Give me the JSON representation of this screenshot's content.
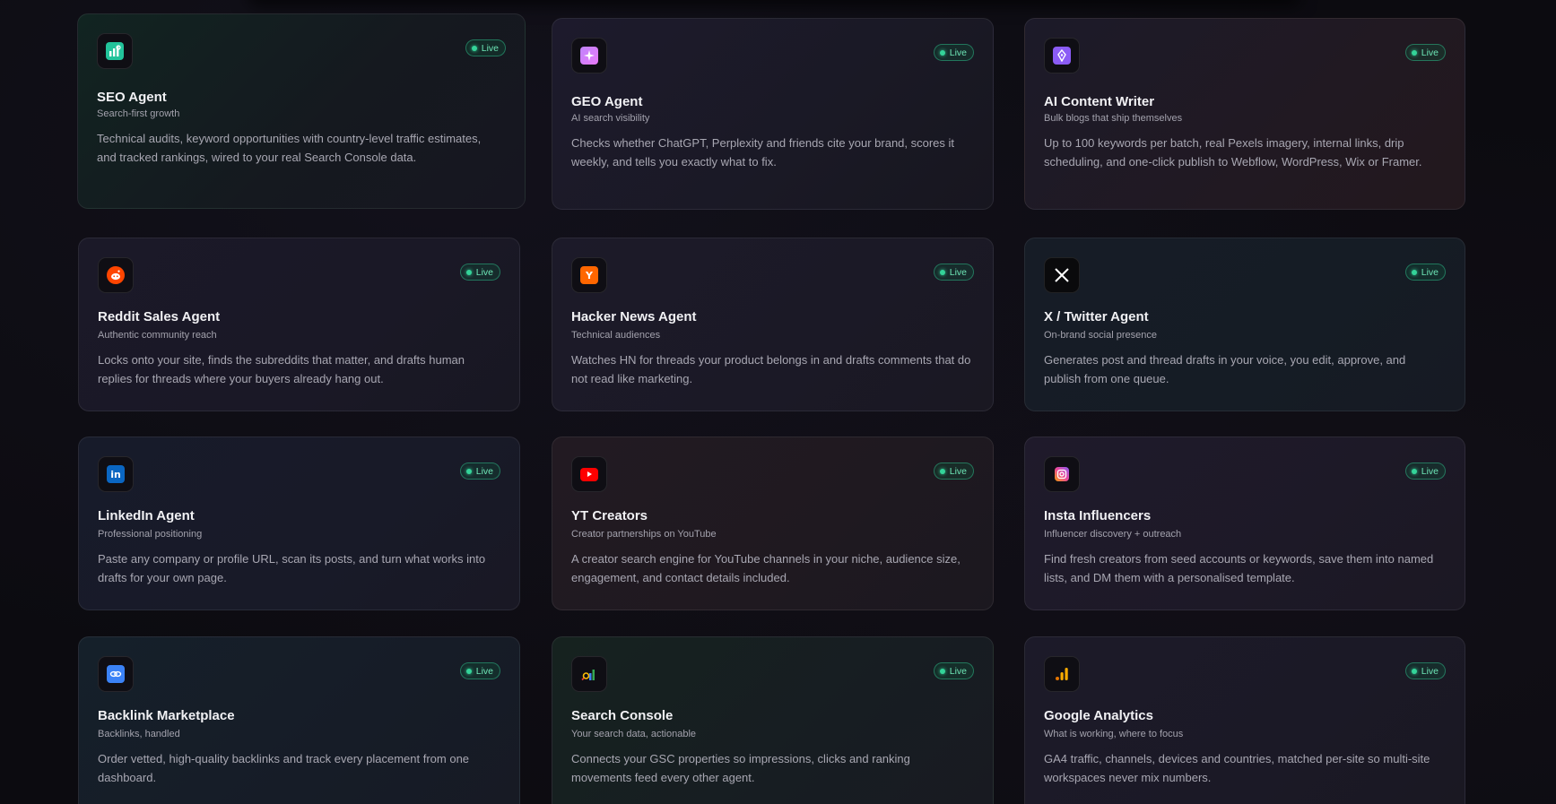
{
  "badge_label": "Live",
  "colors": {
    "accent_green": "#34d399",
    "card_text": "#f1f1f4"
  },
  "cards": [
    {
      "title": "SEO Agent",
      "subtitle": "Search-first growth",
      "description": "Technical audits, keyword opportunities with country-level traffic estimates, and tracked rankings, wired to your real Search Console data.",
      "icon": "bar-chart-icon"
    },
    {
      "title": "GEO Agent",
      "subtitle": "AI search visibility",
      "description": "Checks whether ChatGPT, Perplexity and friends cite your brand, scores it weekly, and tells you exactly what to fix.",
      "icon": "sparkle-icon"
    },
    {
      "title": "AI Content Writer",
      "subtitle": "Bulk blogs that ship themselves",
      "description": "Up to 100 keywords per batch, real Pexels imagery, internal links, drip scheduling, and one-click publish to Webflow, WordPress, Wix or Framer.",
      "icon": "pen-nib-icon"
    },
    {
      "title": "Reddit Sales Agent",
      "subtitle": "Authentic community reach",
      "description": "Locks onto your site, finds the subreddits that matter, and drafts human replies for threads where your buyers already hang out.",
      "icon": "reddit-icon"
    },
    {
      "title": "Hacker News Agent",
      "subtitle": "Technical audiences",
      "description": "Watches HN for threads your product belongs in and drafts comments that do not read like marketing.",
      "icon": "hacker-news-icon"
    },
    {
      "title": "X / Twitter Agent",
      "subtitle": "On-brand social presence",
      "description": "Generates post and thread drafts in your voice, you edit, approve, and publish from one queue.",
      "icon": "x-logo-icon"
    },
    {
      "title": "LinkedIn Agent",
      "subtitle": "Professional positioning",
      "description": "Paste any company or profile URL, scan its posts, and turn what works into drafts for your own page.",
      "icon": "linkedin-icon"
    },
    {
      "title": "YT Creators",
      "subtitle": "Creator partnerships on YouTube",
      "description": "A creator search engine for YouTube channels in your niche, audience size, engagement, and contact details included.",
      "icon": "youtube-icon"
    },
    {
      "title": "Insta Influencers",
      "subtitle": "Influencer discovery + outreach",
      "description": "Find fresh creators from seed accounts or keywords, save them into named lists, and DM them with a personalised template.",
      "icon": "instagram-icon"
    },
    {
      "title": "Backlink Marketplace",
      "subtitle": "Backlinks, handled",
      "description": "Order vetted, high-quality backlinks and track every placement from one dashboard.",
      "icon": "link-icon"
    },
    {
      "title": "Search Console",
      "subtitle": "Your search data, actionable",
      "description": "Connects your GSC properties so impressions, clicks and ranking movements feed every other agent.",
      "icon": "search-console-icon"
    },
    {
      "title": "Google Analytics",
      "subtitle": "What is working, where to focus",
      "description": "GA4 traffic, channels, devices and countries, matched per-site so multi-site workspaces never mix numbers.",
      "icon": "google-analytics-icon"
    }
  ]
}
